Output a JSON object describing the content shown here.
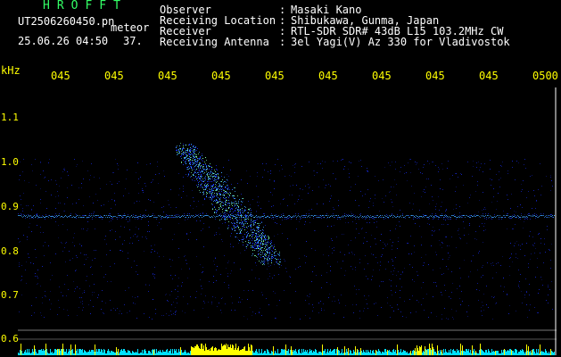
{
  "header": {
    "title": "HROFFT",
    "file_name": "UT2506260450.pn",
    "meteor_label": "meteor",
    "timestamp": "25.06.26 04:50",
    "count": "37."
  },
  "info": [
    {
      "label": "Observer",
      "colon": ":",
      "value": "Masaki Kano"
    },
    {
      "label": "Receiving Location",
      "colon": ":",
      "value": "Shibukawa, Gunma, Japan"
    },
    {
      "label": "Receiver",
      "colon": ":",
      "value": "RTL-SDR SDR# 43dB L15 103.2MHz CW"
    },
    {
      "label": "Receiving Antenna",
      "colon": ":",
      "value": "3el Yagi(V) Az 330 for Vladivostok"
    }
  ],
  "time_axis": {
    "ticks": [
      "045",
      "045",
      "045",
      "045",
      "045",
      "045",
      "045",
      "045",
      "045",
      "0500"
    ]
  },
  "freq_axis": {
    "unit": "kHz",
    "ticks": [
      "1.1",
      "1.0",
      "0.9",
      "0.8",
      "0.7",
      "0.6"
    ]
  },
  "colors": {
    "title": "#33ff66",
    "text": "#ffffff",
    "axis": "#ffff00",
    "carrier": "#3aa0ff",
    "meteor": "#7fffb0",
    "noise": "#1a2fff",
    "bottom_bar_1": "#00e0ff",
    "bottom_bar_2": "#ffff00"
  }
}
